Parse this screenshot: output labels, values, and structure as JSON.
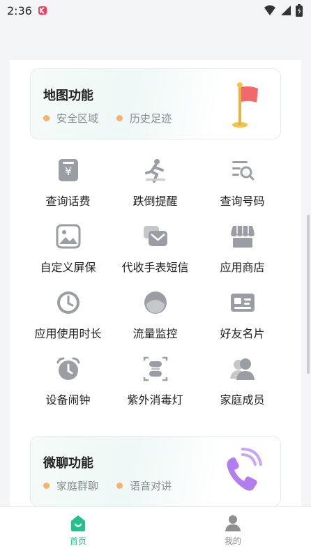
{
  "status_bar": {
    "time": "2:36"
  },
  "cards": [
    {
      "title": "地图功能",
      "tags": [
        "安全区域",
        "历史足迹"
      ]
    },
    {
      "title": "微聊功能",
      "tags": [
        "家庭群聊",
        "语音对讲"
      ]
    }
  ],
  "grid": [
    {
      "label": "查询话费",
      "icon": "bill-icon"
    },
    {
      "label": "跌倒提醒",
      "icon": "fall-person-icon"
    },
    {
      "label": "查询号码",
      "icon": "search-list-icon"
    },
    {
      "label": "自定义屏保",
      "icon": "image-icon"
    },
    {
      "label": "代收手表短信",
      "icon": "message-icon"
    },
    {
      "label": "应用商店",
      "icon": "store-icon"
    },
    {
      "label": "应用使用时长",
      "icon": "clock-icon"
    },
    {
      "label": "流量监控",
      "icon": "data-gauge-icon"
    },
    {
      "label": "好友名片",
      "icon": "contact-card-icon"
    },
    {
      "label": "设备闹钟",
      "icon": "alarm-clock-icon"
    },
    {
      "label": "紫外消毒灯",
      "icon": "uv-lamp-icon"
    },
    {
      "label": "家庭成员",
      "icon": "family-members-icon"
    }
  ],
  "bottom_nav": [
    {
      "label": "首页",
      "icon": "home-icon",
      "active": true
    },
    {
      "label": "我的",
      "icon": "profile-icon",
      "active": false
    }
  ],
  "colors": {
    "accent": "#22c08a",
    "icon_gray": "#9a9da3",
    "tag_dot": "#f7b26b",
    "inactive_nav": "#8f8f8f"
  }
}
